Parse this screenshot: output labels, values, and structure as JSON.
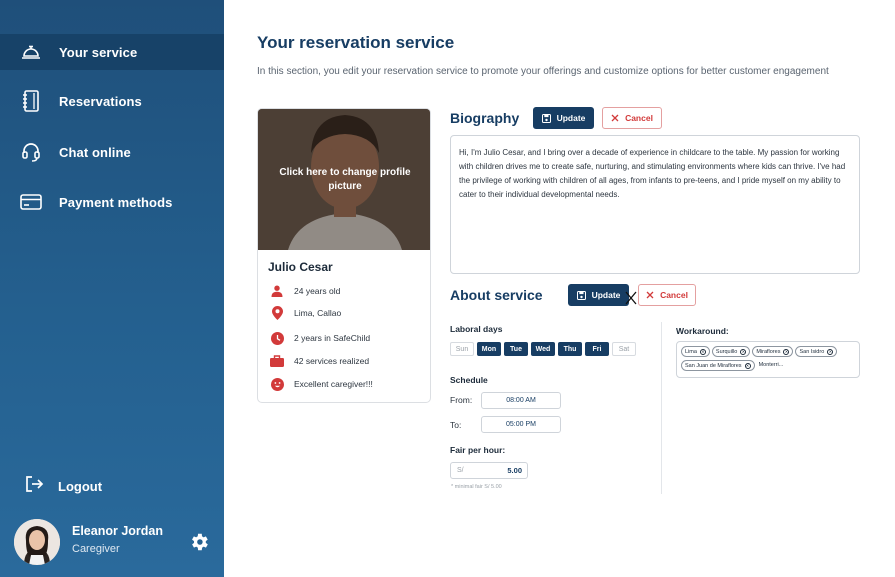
{
  "sidebar": {
    "items": [
      {
        "label": "Your service",
        "icon": "bell-service-icon"
      },
      {
        "label": "Reservations",
        "icon": "notebook-icon"
      },
      {
        "label": "Chat online",
        "icon": "headset-icon"
      },
      {
        "label": "Payment methods",
        "icon": "credit-card-icon"
      }
    ],
    "logout_label": "Logout",
    "user": {
      "name": "Eleanor Jordan",
      "role": "Caregiver"
    }
  },
  "page": {
    "title": "Your reservation service",
    "subtitle": "In this section, you edit your reservation service to promote your offerings and customize options for better customer engagement"
  },
  "profile": {
    "photo_hint": "Click here to change profile picture",
    "name": "Julio Cesar",
    "details": [
      {
        "icon": "person-icon",
        "text": "24 years old"
      },
      {
        "icon": "location-pin-icon",
        "text": "Lima, Callao"
      },
      {
        "icon": "clock-icon",
        "text": "2 years in SafeChild"
      },
      {
        "icon": "briefcase-icon",
        "text": "42 services realized"
      },
      {
        "icon": "smile-icon",
        "text": "Excellent caregiver!!!"
      }
    ]
  },
  "biography": {
    "title": "Biography",
    "update_label": "Update",
    "cancel_label": "Cancel",
    "text": "Hi, I'm Julio Cesar, and I bring over a decade of experience in childcare to the table. My passion for working with children drives me to create safe, nurturing, and stimulating environments where kids can thrive. I've had the privilege of working with children of all ages, from infants to pre-teens, and I pride myself on my ability to cater to their individual developmental needs."
  },
  "about": {
    "title": "About service",
    "update_label": "Update",
    "cancel_label": "Cancel",
    "laboral_days_label": "Laboral days",
    "days": [
      {
        "label": "Sun",
        "active": false
      },
      {
        "label": "Mon",
        "active": true
      },
      {
        "label": "Tue",
        "active": true
      },
      {
        "label": "Wed",
        "active": true
      },
      {
        "label": "Thu",
        "active": true
      },
      {
        "label": "Fri",
        "active": true
      },
      {
        "label": "Sat",
        "active": false
      }
    ],
    "schedule_label": "Schedule",
    "from_label": "From:",
    "from_value": "08:00 AM",
    "to_label": "To:",
    "to_value": "05:00 PM",
    "fair_label": "Fair per hour:",
    "currency": "S/",
    "fair_value": "5.00",
    "fair_note": "* minimal fair S/ 5.00",
    "workaround_label": "Workaround:",
    "districts": [
      "Lima",
      "Surquillo",
      "Miraflores",
      "San Isidro",
      "San Juan de Miraflores"
    ],
    "district_input": "Monterri..."
  },
  "colors": {
    "primary": "#173d63",
    "sidebar": "#1f4f7a",
    "accent_red": "#d23a3a"
  }
}
